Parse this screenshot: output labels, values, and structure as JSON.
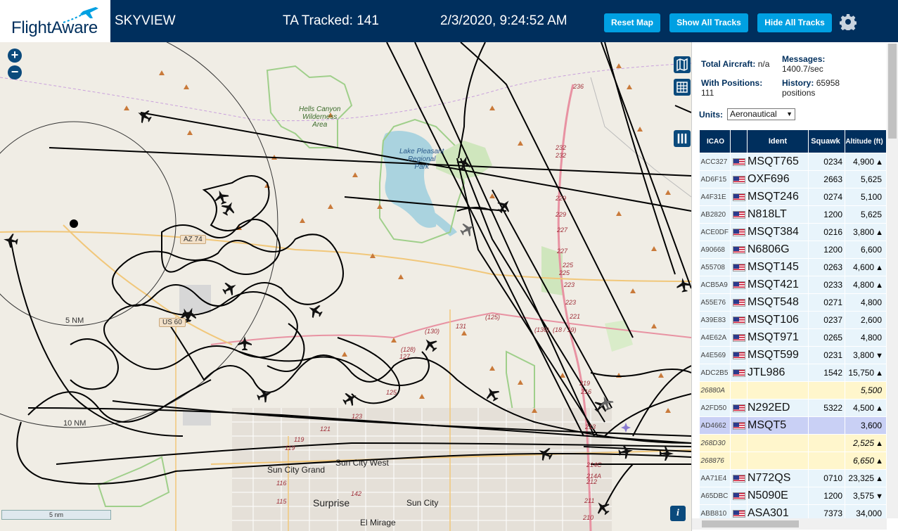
{
  "header": {
    "logo_text": "FlightAware",
    "app_name": "SKYVIEW",
    "tracked_label": "TA Tracked: 141",
    "datetime": "2/3/2020, 9:24:52 AM",
    "buttons": {
      "reset_map": "Reset Map",
      "show_all": "Show All Tracks",
      "hide_all": "Hide All Tracks"
    }
  },
  "map": {
    "zoom_in": "+",
    "zoom_out": "−",
    "range_ring_5": "5 NM",
    "range_ring_10": "10 NM",
    "scale": "5 nm",
    "places": {
      "hells_canyon": "Hells Canyon\nWilderness\nArea",
      "lake_pleasant": "Lake Pleasant\nRegional\nPark",
      "sun_city_grand": "Sun City Grand",
      "sun_city_west": "Sun City West",
      "sun_city": "Sun City",
      "surprise": "Surprise",
      "el_mirage": "El Mirage"
    },
    "shields": {
      "az74": "AZ 74",
      "us60": "US 60"
    },
    "route_numbers": [
      "236",
      "232",
      "232",
      "229",
      "229",
      "227",
      "227",
      "225",
      "225",
      "223",
      "223",
      "221",
      "(130)",
      "131",
      "(128)",
      "127",
      "125",
      "123",
      "121",
      "119",
      "119",
      "116",
      "115",
      "142",
      "213",
      "212",
      "211",
      "210",
      "214A",
      "214C",
      "219",
      "216",
      "(125)",
      "(136)",
      "(18 / 19)"
    ],
    "info_icon": "i"
  },
  "panel": {
    "total_aircraft_label": "Total Aircraft:",
    "total_aircraft_value": "n/a",
    "with_positions_label": "With Positions:",
    "with_positions_value": "111",
    "messages_label": "Messages:",
    "messages_value": "1400.7/sec",
    "history_label": "History:",
    "history_value": "65958",
    "history_unit": "positions",
    "units_label": "Units:",
    "units_value": "Aeronautical",
    "columns": [
      "ICAO",
      "",
      "Ident",
      "Squawk",
      "Altitude (ft)"
    ],
    "rows": [
      {
        "icao": "ACC327",
        "flag": true,
        "ident": "MSQT765",
        "squawk": "0234",
        "alt": "4,900",
        "trend": "▲",
        "style": "r"
      },
      {
        "icao": "AD6F15",
        "flag": true,
        "ident": "OXF696",
        "squawk": "2663",
        "alt": "5,625",
        "trend": "",
        "style": "r"
      },
      {
        "icao": "A4F31E",
        "flag": true,
        "ident": "MSQT246",
        "squawk": "0274",
        "alt": "5,100",
        "trend": "",
        "style": "r"
      },
      {
        "icao": "AB2820",
        "flag": true,
        "ident": "N818LT",
        "squawk": "1200",
        "alt": "5,625",
        "trend": "",
        "style": "r"
      },
      {
        "icao": "ACE0DF",
        "flag": true,
        "ident": "MSQT384",
        "squawk": "0216",
        "alt": "3,800",
        "trend": "▲",
        "style": "r"
      },
      {
        "icao": "A90668",
        "flag": true,
        "ident": "N6806G",
        "squawk": "1200",
        "alt": "6,600",
        "trend": "",
        "style": "r"
      },
      {
        "icao": "A55708",
        "flag": true,
        "ident": "MSQT145",
        "squawk": "0263",
        "alt": "4,600",
        "trend": "▲",
        "style": "r"
      },
      {
        "icao": "ACB5A9",
        "flag": true,
        "ident": "MSQT421",
        "squawk": "0233",
        "alt": "4,800",
        "trend": "▲",
        "style": "r"
      },
      {
        "icao": "A55E76",
        "flag": true,
        "ident": "MSQT548",
        "squawk": "0271",
        "alt": "4,800",
        "trend": "",
        "style": "r"
      },
      {
        "icao": "A39E83",
        "flag": true,
        "ident": "MSQT106",
        "squawk": "0237",
        "alt": "2,600",
        "trend": "",
        "style": "r"
      },
      {
        "icao": "A4E62A",
        "flag": true,
        "ident": "MSQT971",
        "squawk": "0265",
        "alt": "4,800",
        "trend": "",
        "style": "r"
      },
      {
        "icao": "A4E569",
        "flag": true,
        "ident": "MSQT599",
        "squawk": "0231",
        "alt": "3,800",
        "trend": "▼",
        "style": "r"
      },
      {
        "icao": "ADC2B5",
        "flag": true,
        "ident": "JTL986",
        "squawk": "1542",
        "alt": "15,750",
        "trend": "▲",
        "style": "r"
      },
      {
        "icao": "26880A",
        "flag": false,
        "ident": "",
        "squawk": "",
        "alt": "5,500",
        "trend": "",
        "style": "y"
      },
      {
        "icao": "A2FD50",
        "flag": true,
        "ident": "N292ED",
        "squawk": "5322",
        "alt": "4,500",
        "trend": "▲",
        "style": "r"
      },
      {
        "icao": "AD4662",
        "flag": true,
        "ident": "MSQT5",
        "squawk": "",
        "alt": "3,600",
        "trend": "",
        "style": "s"
      },
      {
        "icao": "268D30",
        "flag": false,
        "ident": "",
        "squawk": "",
        "alt": "2,525",
        "trend": "▲",
        "style": "y"
      },
      {
        "icao": "268876",
        "flag": false,
        "ident": "",
        "squawk": "",
        "alt": "6,650",
        "trend": "▲",
        "style": "y"
      },
      {
        "icao": "AA71E4",
        "flag": true,
        "ident": "N772QS",
        "squawk": "0710",
        "alt": "23,325",
        "trend": "▲",
        "style": "r"
      },
      {
        "icao": "A65DBC",
        "flag": true,
        "ident": "N5090E",
        "squawk": "1200",
        "alt": "3,575",
        "trend": "▼",
        "style": "r"
      },
      {
        "icao": "ABB810",
        "flag": true,
        "ident": "ASA301",
        "squawk": "7373",
        "alt": "34,000",
        "trend": "",
        "style": "r"
      }
    ]
  },
  "colors": {
    "header_bg": "#002f5d",
    "button_bg": "#00a0e2",
    "selected_row": "#c9d0f5",
    "unknown_row": "#fff6cc"
  }
}
